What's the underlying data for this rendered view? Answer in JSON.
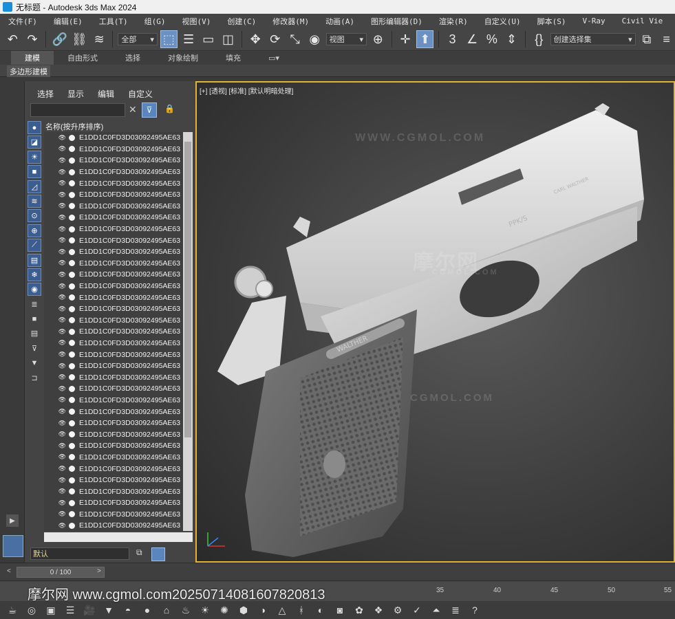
{
  "window": {
    "title": "无标题 - Autodesk 3ds Max 2024"
  },
  "menu": [
    "文件(F)",
    "编辑(E)",
    "工具(T)",
    "组(G)",
    "视图(V)",
    "创建(C)",
    "修改器(M)",
    "动画(A)",
    "图形编辑器(D)",
    "渲染(R)",
    "自定义(U)",
    "脚本(S)",
    "V-Ray",
    "Civil Vie"
  ],
  "toolbar": {
    "filter_select": "全部",
    "view_select": "视图",
    "selection_set": "创建选择集"
  },
  "ribbon": {
    "tabs": [
      "建模",
      "自由形式",
      "选择",
      "对象绘制",
      "填充"
    ],
    "active_tab": "建模",
    "sub_label": "多边形建模"
  },
  "explorer": {
    "menu": [
      "选择",
      "显示",
      "编辑",
      "自定义"
    ],
    "column_header": "名称(按升序排序)",
    "rows": [
      "E1DD1C0FD3D03092495AE63",
      "E1DD1C0FD3D03092495AE63",
      "E1DD1C0FD3D03092495AE63",
      "E1DD1C0FD3D03092495AE63",
      "E1DD1C0FD3D03092495AE63",
      "E1DD1C0FD3D03092495AE63",
      "E1DD1C0FD3D03092495AE63",
      "E1DD1C0FD3D03092495AE63",
      "E1DD1C0FD3D03092495AE63",
      "E1DD1C0FD3D03092495AE63",
      "E1DD1C0FD3D03092495AE63",
      "E1DD1C0FD3D03092495AE63",
      "E1DD1C0FD3D03092495AE63",
      "E1DD1C0FD3D03092495AE63",
      "E1DD1C0FD3D03092495AE63",
      "E1DD1C0FD3D03092495AE63",
      "E1DD1C0FD3D03092495AE63",
      "E1DD1C0FD3D03092495AE63",
      "E1DD1C0FD3D03092495AE63",
      "E1DD1C0FD3D03092495AE63",
      "E1DD1C0FD3D03092495AE63",
      "E1DD1C0FD3D03092495AE63",
      "E1DD1C0FD3D03092495AE63",
      "E1DD1C0FD3D03092495AE63",
      "E1DD1C0FD3D03092495AE63",
      "E1DD1C0FD3D03092495AE63",
      "E1DD1C0FD3D03092495AE63",
      "E1DD1C0FD3D03092495AE63",
      "E1DD1C0FD3D03092495AE63",
      "E1DD1C0FD3D03092495AE63",
      "E1DD1C0FD3D03092495AE63",
      "E1DD1C0FD3D03092495AE63",
      "E1DD1C0FD3D03092495AE63",
      "E1DD1C0FD3D03092495AE63",
      "E1DD1C0FD3D03092495AE63"
    ],
    "layer_select": "默认"
  },
  "viewport": {
    "label": "[+] [透视] [标准] [默认明暗处理]",
    "watermark_top": "WWW.CGMOL.COM",
    "watermark_mid": "摩尔网",
    "watermark_mid2": "CGMOL.COM",
    "watermark_low": "CGMOL.COM",
    "grip_emblem": "WALTHER",
    "slide_text1": "PPK/S",
    "slide_text2": "CARL WALTHER",
    "border_color": "#e3b533"
  },
  "time": {
    "slider_text": "0 / 100",
    "ticks": [
      "35",
      "40",
      "45",
      "50",
      "55"
    ]
  },
  "overlay_url": "摩尔网 www.cgmol.com20250714081607820813"
}
